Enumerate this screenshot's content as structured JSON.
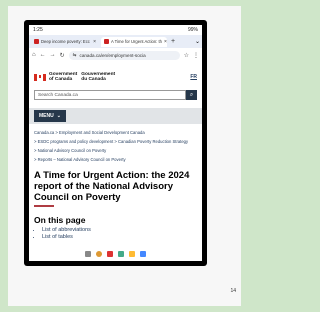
{
  "status": {
    "time": "1:25",
    "battery": "99%"
  },
  "tabs": [
    {
      "label": "Deep income poverty: Ecc"
    },
    {
      "label": "A Time for Urgent Action: th"
    }
  ],
  "url": "canada.ca/en/employment-socia",
  "gov": {
    "en": "Government\nof Canada",
    "fr": "Gouvernement\ndu Canada",
    "lang": "FR"
  },
  "search": {
    "placeholder": "Search Canada.ca"
  },
  "menu": {
    "label": "MENU"
  },
  "breadcrumbs": [
    "Canada.ca > Employment and Social Development Canada",
    "> ESDC programs and policy development > Canadian Poverty Reduction Strategy",
    "> National Advisory Council on Poverty",
    "> Reports – National Advisory Council on Poverty"
  ],
  "title": "A Time for Urgent Action: the 2024 report of the National Advisory Council on Poverty",
  "onthispage": {
    "heading": "On this page",
    "items": [
      "List of abbreviations",
      "List of tables"
    ]
  },
  "page_number": "14",
  "colors": {
    "background": "#cfe6c9",
    "gov_blue": "#26374a",
    "accent_red": "#af3c43"
  }
}
